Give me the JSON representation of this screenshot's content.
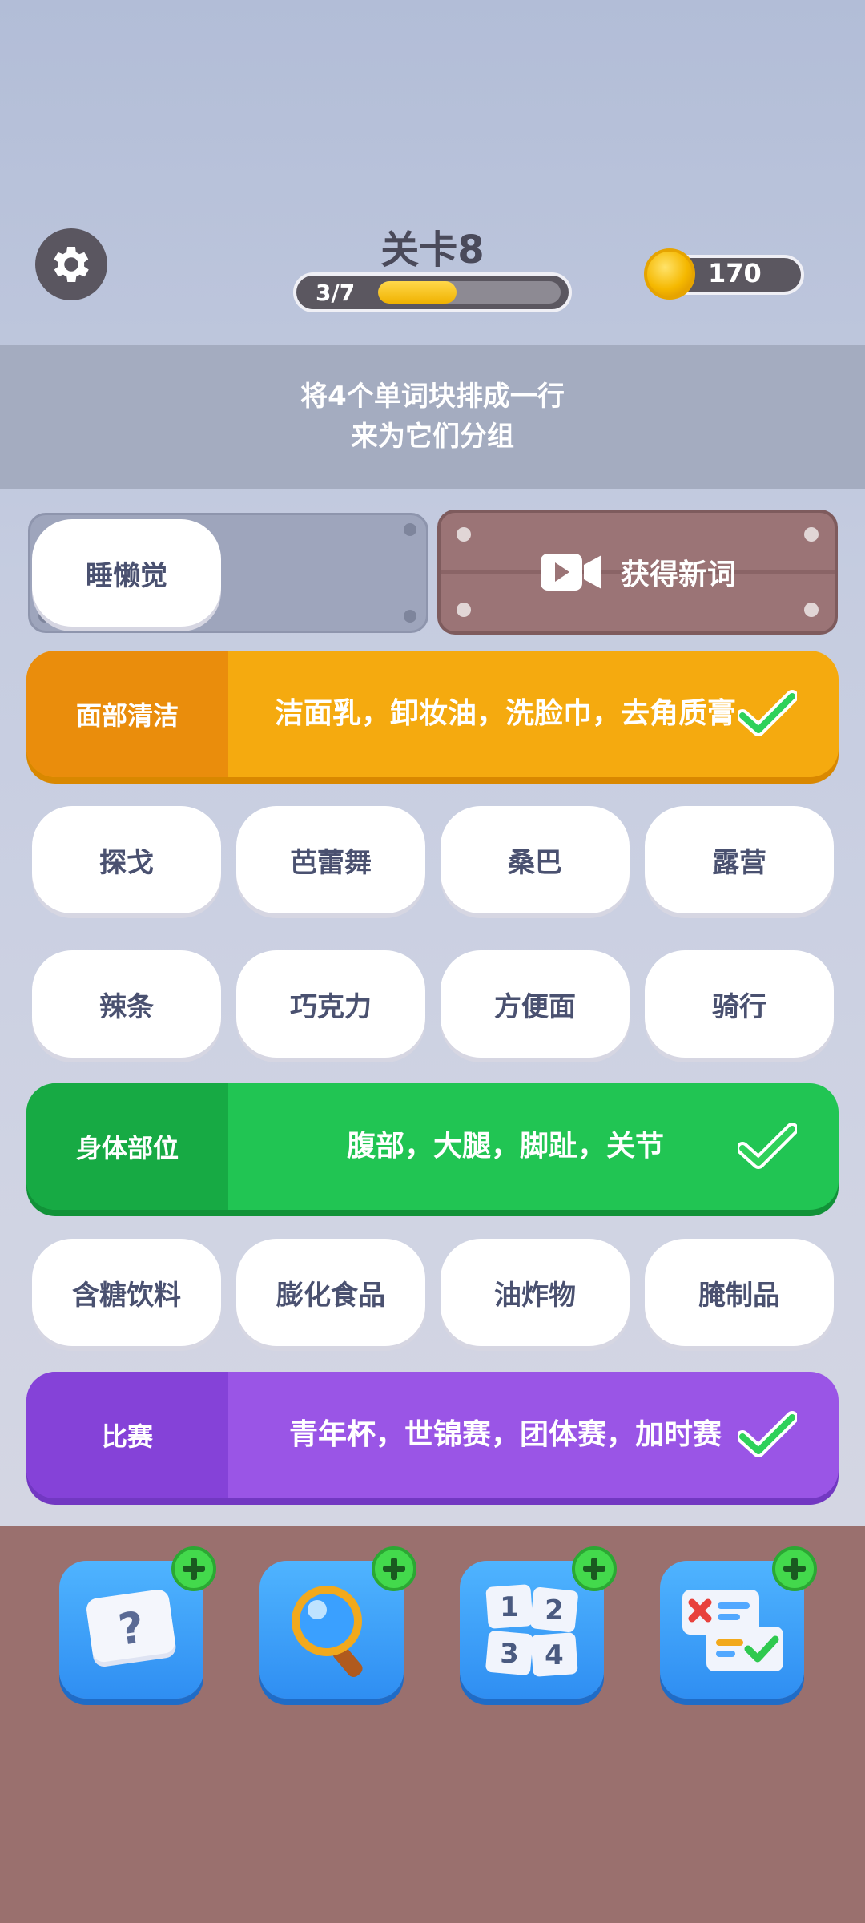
{
  "header": {
    "level_title": "关卡8",
    "progress_text": "3/7",
    "progress_fraction": 0.43,
    "coins": "170"
  },
  "banner": {
    "line1": "将4个单词块排成一行",
    "line2": "来为它们分组"
  },
  "selection": {
    "selected_word": "睡懒觉",
    "get_word_label": "获得新词"
  },
  "groups": [
    {
      "category": "面部清洁",
      "words": "洁面乳，卸妆油，洗脸巾，去角质膏",
      "color": "#f5aa0f"
    },
    {
      "category": "身体部位",
      "words": "腹部，大腿，脚趾，关节",
      "color": "#21c553"
    },
    {
      "category": "比赛",
      "words": "青年杯，世锦赛，团体赛，加时赛",
      "color": "#9a55e6"
    }
  ],
  "tiles_row1": [
    "探戈",
    "芭蕾舞",
    "桑巴",
    "露营"
  ],
  "tiles_row2": [
    "辣条",
    "巧克力",
    "方便面",
    "骑行"
  ],
  "tiles_row3": [
    "含糖饮料",
    "膨化食品",
    "油炸物",
    "腌制品"
  ],
  "boosters": [
    {
      "icon": "question-card-icon"
    },
    {
      "icon": "magnifier-icon"
    },
    {
      "icon": "number-cards-icon"
    },
    {
      "icon": "check-list-icon"
    }
  ]
}
